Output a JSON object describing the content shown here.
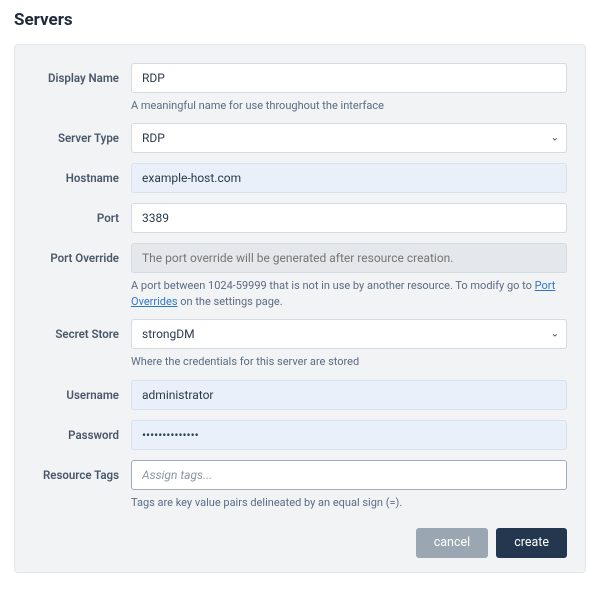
{
  "title": "Servers",
  "fields": {
    "display_name": {
      "label": "Display Name",
      "value": "RDP",
      "hint": "A meaningful name for use throughout the interface"
    },
    "server_type": {
      "label": "Server Type",
      "value": "RDP"
    },
    "hostname": {
      "label": "Hostname",
      "value": "example-host.com"
    },
    "port": {
      "label": "Port",
      "value": "3389"
    },
    "port_override": {
      "label": "Port Override",
      "placeholder": "The port override will be generated after resource creation.",
      "hint_pre": "A port between 1024-59999 that is not in use by another resource. To modify go to ",
      "hint_link": "Port Overrides",
      "hint_post": " on the settings page."
    },
    "secret_store": {
      "label": "Secret Store",
      "value": "strongDM",
      "hint": "Where the credentials for this server are stored"
    },
    "username": {
      "label": "Username",
      "value": "administrator"
    },
    "password": {
      "label": "Password",
      "value": "••••••••••••••"
    },
    "resource_tags": {
      "label": "Resource Tags",
      "placeholder": "Assign tags...",
      "hint": "Tags are key value pairs delineated by an equal sign (=)."
    }
  },
  "actions": {
    "cancel": "cancel",
    "create": "create"
  }
}
